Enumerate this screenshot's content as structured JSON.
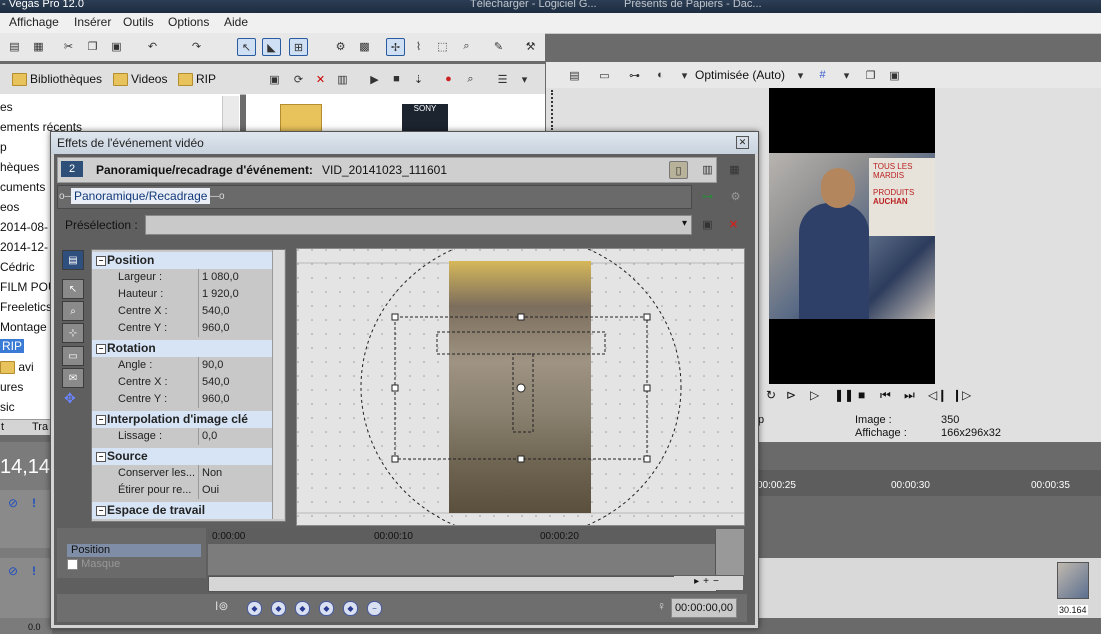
{
  "window": {
    "title": "- Vegas Pro 12.0",
    "bg_tabs": [
      "Télécharger - Logiciel G...",
      "Présents de Papiers - Dac..."
    ]
  },
  "menu": [
    "Affichage",
    "Insérer",
    "Outils",
    "Options",
    "Aide"
  ],
  "explorer": {
    "breadcrumbs": [
      "Bibliothèques",
      "Videos",
      "RIP"
    ],
    "tree": [
      "es",
      "ements récents",
      "p",
      "hèques",
      "cuments",
      "eos",
      "2014-08-",
      "2014-12-",
      "Cédric",
      "FILM POU",
      "Freeletics",
      "Montage",
      "RIP",
      "avi",
      "ures",
      "sic"
    ],
    "selected": "RIP",
    "file_label": "SONY",
    "tabs": [
      "t",
      "Tra"
    ],
    "timecode": "14,14"
  },
  "preview": {
    "quality": "Optimisée (Auto)",
    "labels": {
      "image": "Image :",
      "display": "Affichage :"
    },
    "values": {
      "image": "350",
      "display": "166x296x32"
    },
    "left_label": "p",
    "sign_text": [
      "TOUS LES",
      "MARDIS",
      "PRODUITS",
      "AUCHAN"
    ]
  },
  "timeline": {
    "ticks": [
      "00:00:25",
      "00:00:30",
      "00:00:35"
    ],
    "clip_label": "30.164",
    "left_values": [
      "0.0"
    ]
  },
  "dialog": {
    "title": "Effets de l'événement vidéo",
    "track_num": "2",
    "header_label": "Panoramique/recadrage d'événement:",
    "header_file": "VID_20141023_111601",
    "chain_item": "Panoramique/Recadrage",
    "preset_label": "Présélection :",
    "groups": {
      "position": {
        "title": "Position",
        "rows": [
          {
            "label": "Largeur :",
            "value": "1 080,0"
          },
          {
            "label": "Hauteur :",
            "value": "1 920,0"
          },
          {
            "label": "Centre X :",
            "value": "540,0"
          },
          {
            "label": "Centre Y :",
            "value": "960,0"
          }
        ]
      },
      "rotation": {
        "title": "Rotation",
        "rows": [
          {
            "label": "Angle :",
            "value": "90,0"
          },
          {
            "label": "Centre X :",
            "value": "540,0"
          },
          {
            "label": "Centre Y :",
            "value": "960,0"
          }
        ]
      },
      "interp": {
        "title": "Interpolation d'image clé",
        "rows": [
          {
            "label": "Lissage :",
            "value": "0,0"
          }
        ]
      },
      "source": {
        "title": "Source",
        "rows": [
          {
            "label": "Conserver les...",
            "value": "Non"
          },
          {
            "label": "Étirer pour re...",
            "value": "Oui"
          }
        ]
      },
      "workspace": {
        "title": "Espace de travail"
      }
    },
    "keyframes": {
      "tracks": [
        "Position",
        "Masque"
      ],
      "ruler": [
        "0:00:00",
        "00:00:10",
        "00:00:20"
      ],
      "timecode": "00:00:00,00"
    }
  }
}
